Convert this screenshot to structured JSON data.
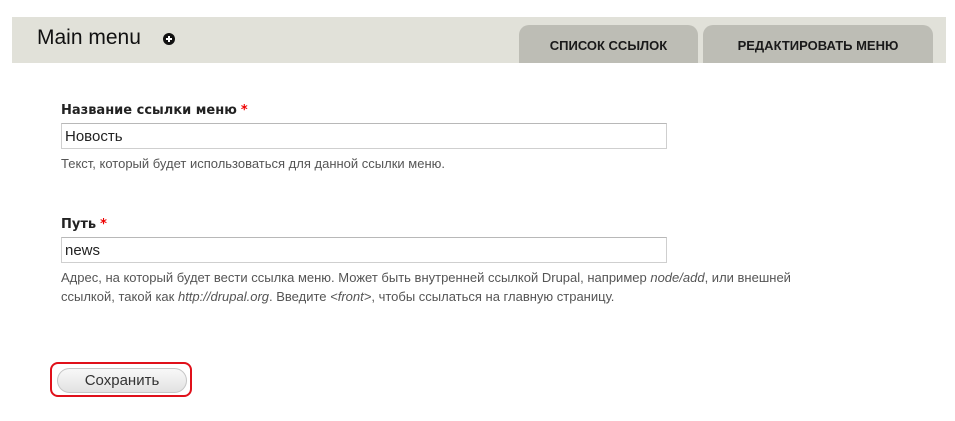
{
  "header": {
    "title": "Main menu",
    "tabs": [
      {
        "label": "СПИСОК ССЫЛОК"
      },
      {
        "label": "РЕДАКТИРОВАТЬ МЕНЮ"
      }
    ]
  },
  "form": {
    "link_title": {
      "label": "Название ссылки меню",
      "required_mark": "*",
      "value": "Новость",
      "description": "Текст, который будет использоваться для данной ссылки меню."
    },
    "path": {
      "label": "Путь",
      "required_mark": "*",
      "value": "news",
      "description_line1_part1": "Адрес, на который будет вести ссылка меню. Может быть внутренней ссылкой Drupal, например ",
      "description_line1_em1": "node/add",
      "description_line1_part2": ", или внешней",
      "description_line2_part1": "ссылкой, такой как ",
      "description_line2_em1": "http://drupal.org",
      "description_line2_part2": ". Введите ",
      "description_line2_em2": "<front>",
      "description_line2_part3": ", чтобы ссылаться на главную страницу."
    },
    "save_label": "Сохранить"
  },
  "colors": {
    "header_bg": "#e1e1d9",
    "tab_bg": "#bdbdb5",
    "required": "#ee0000",
    "highlight": "#e0101a"
  },
  "icons": {
    "shortcut": "add-shortcut-icon"
  }
}
